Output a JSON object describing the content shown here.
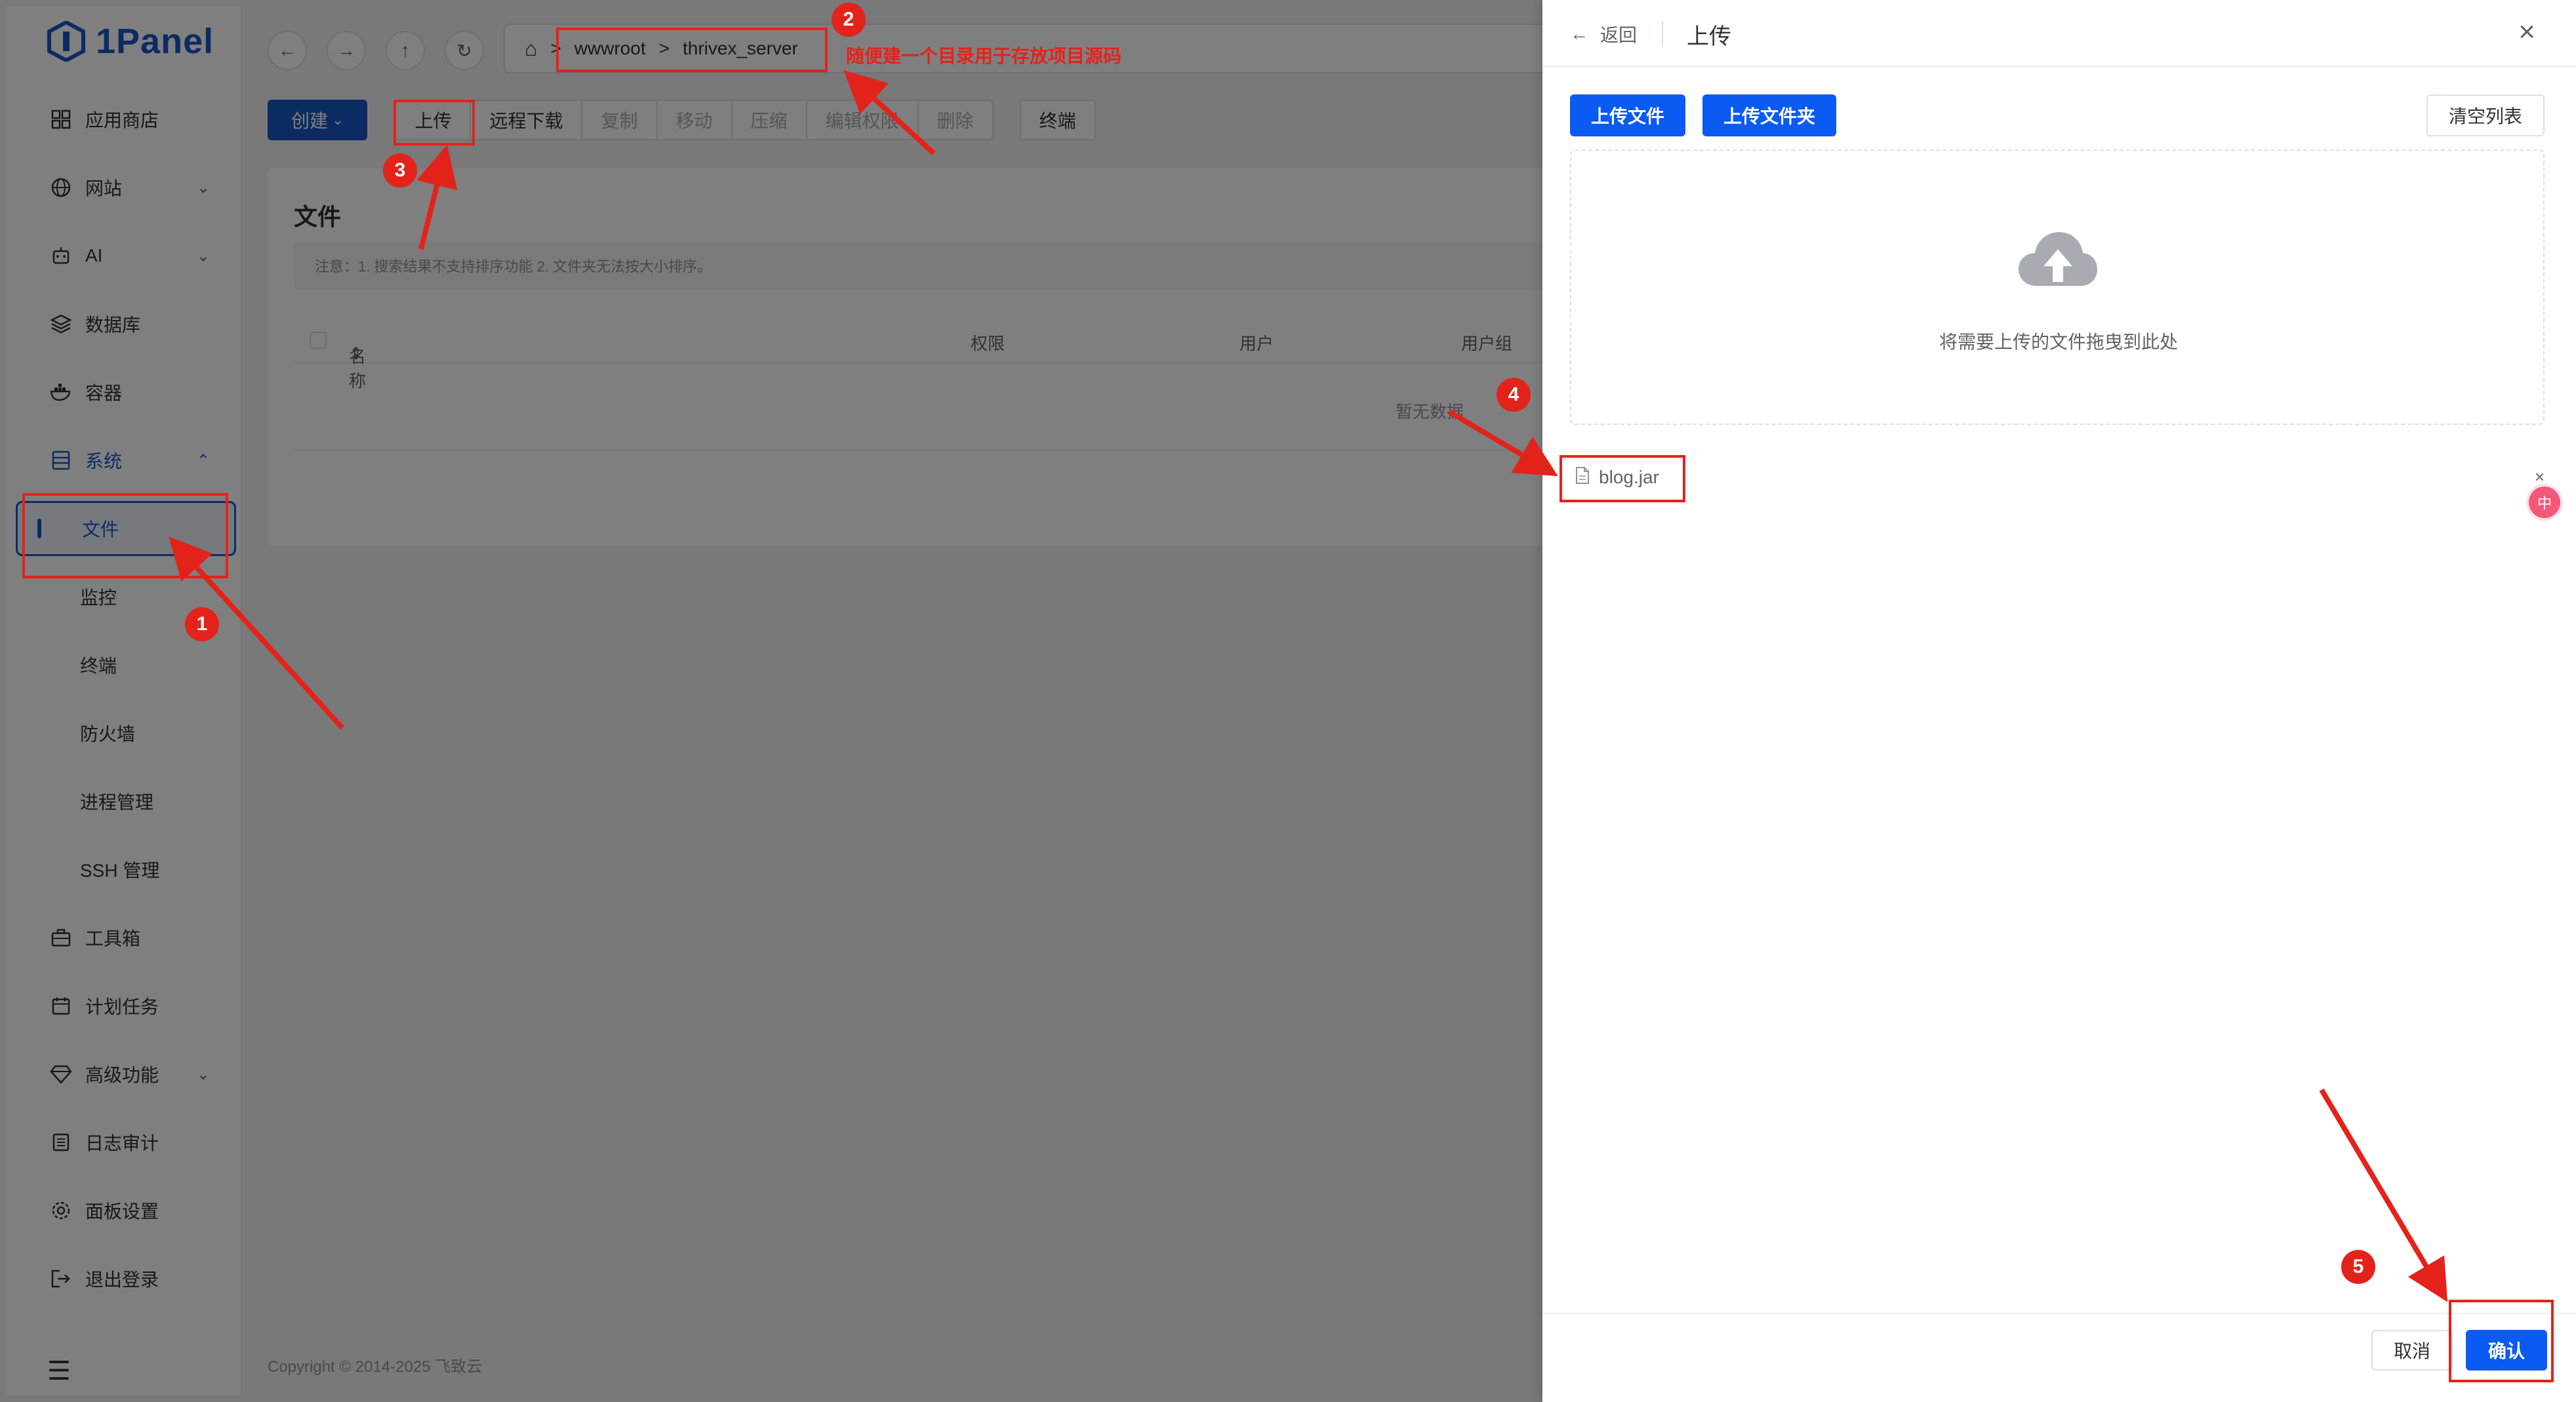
{
  "app": {
    "logo_text": "1Panel"
  },
  "sidebar": {
    "items": [
      {
        "label": "应用商店",
        "icon": "grid-icon"
      },
      {
        "label": "网站",
        "icon": "globe-icon"
      },
      {
        "label": "AI",
        "icon": "robot-icon"
      },
      {
        "label": "数据库",
        "icon": "layers-icon"
      },
      {
        "label": "容器",
        "icon": "docker-icon"
      },
      {
        "label": "系统",
        "icon": "server-icon"
      }
    ],
    "sub_items": [
      {
        "label": "文件"
      },
      {
        "label": "监控"
      },
      {
        "label": "终端"
      },
      {
        "label": "防火墙"
      },
      {
        "label": "进程管理"
      },
      {
        "label": "SSH 管理"
      }
    ],
    "bottom_items": [
      {
        "label": "工具箱",
        "icon": "toolbox-icon"
      },
      {
        "label": "计划任务",
        "icon": "calendar-icon"
      },
      {
        "label": "高级功能",
        "icon": "diamond-icon"
      },
      {
        "label": "日志审计",
        "icon": "log-icon"
      },
      {
        "label": "面板设置",
        "icon": "gear-icon"
      },
      {
        "label": "退出登录",
        "icon": "logout-icon"
      }
    ]
  },
  "path": {
    "sep": ">",
    "segments": [
      "wwwroot",
      "thrivex_server"
    ]
  },
  "toolbar": {
    "create_label": "创建",
    "buttons": [
      "上传",
      "远程下载",
      "复制",
      "移动",
      "压缩",
      "编辑权限",
      "删除"
    ],
    "terminal_label": "终端"
  },
  "file_card": {
    "title": "文件",
    "notice": "注意：1. 搜索结果不支持排序功能 2. 文件夹无法按大小排序。",
    "columns": [
      "名称",
      "权限",
      "用户",
      "用户组"
    ],
    "empty_text": "暂无数据"
  },
  "footer": {
    "copyright": "Copyright © 2014-2025 飞致云"
  },
  "drawer": {
    "back_label": "返回",
    "title": "上传",
    "upload_file_label": "上传文件",
    "upload_folder_label": "上传文件夹",
    "clear_label": "清空列表",
    "drop_text": "将需要上传的文件拖曳到此处",
    "file_name": "blog.jar",
    "cancel_label": "取消",
    "confirm_label": "确认"
  },
  "annotations": {
    "note": "随便建一个目录用于存放项目源码",
    "badges": [
      "1",
      "2",
      "3",
      "4",
      "5"
    ],
    "color": "#e3231b"
  },
  "colors": {
    "primary": "#1a56c6",
    "drawer_button": "#0b5bf3"
  }
}
